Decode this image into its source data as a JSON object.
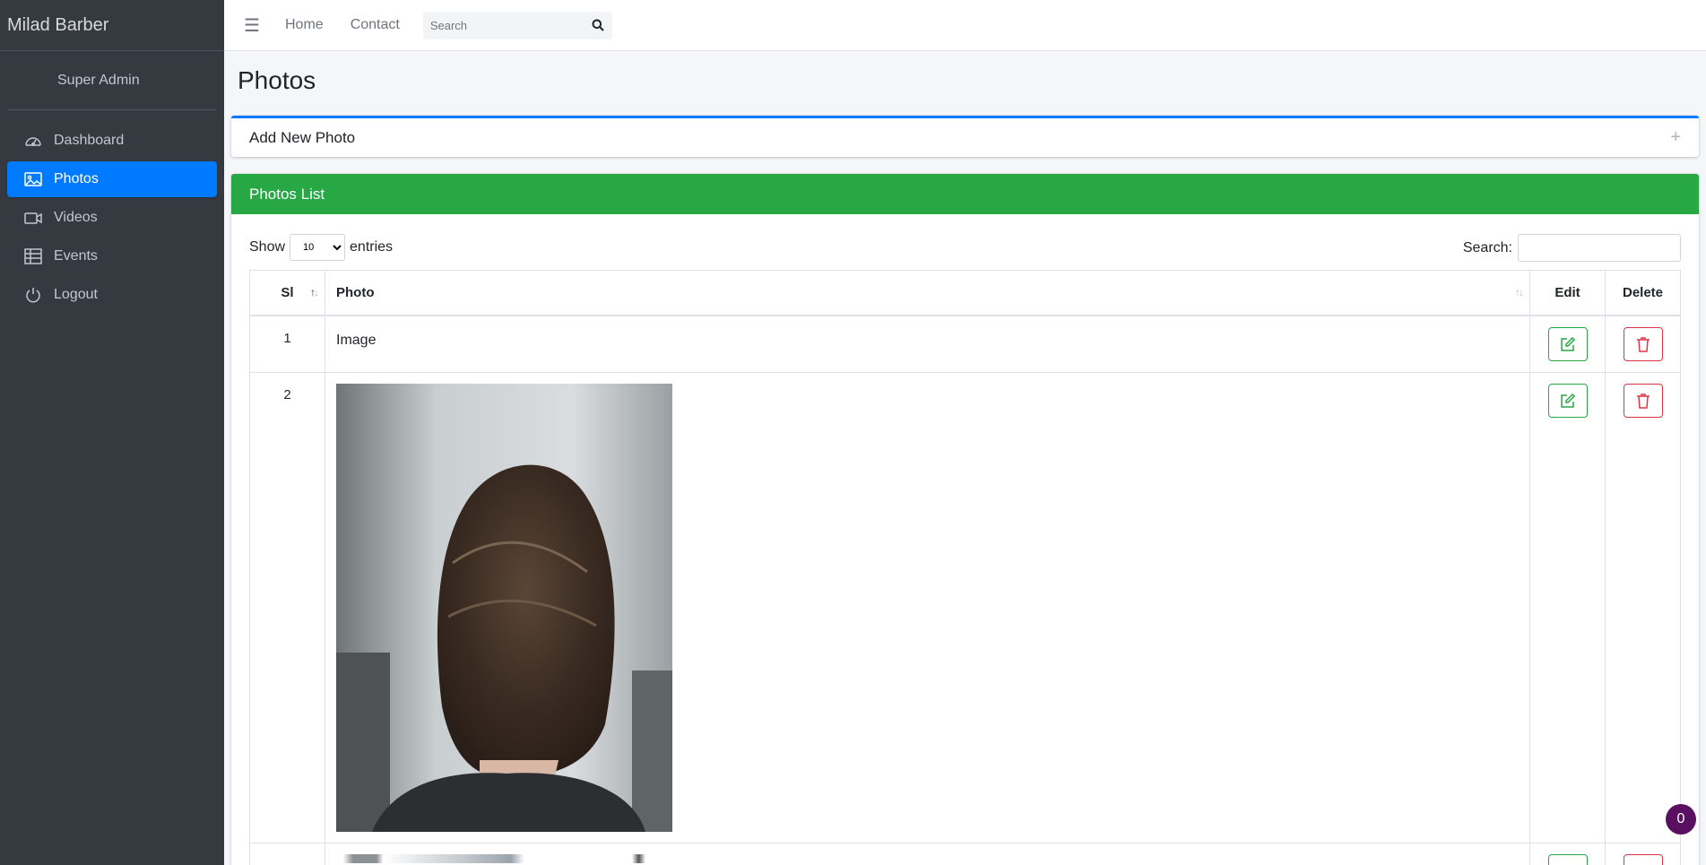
{
  "brand": "Milad Barber",
  "user": "Super Admin",
  "sidebar": {
    "items": [
      {
        "label": "Dashboard",
        "icon": "dashboard-icon"
      },
      {
        "label": "Photos",
        "icon": "image-icon",
        "active": true
      },
      {
        "label": "Videos",
        "icon": "video-icon"
      },
      {
        "label": "Events",
        "icon": "table-icon"
      },
      {
        "label": "Logout",
        "icon": "power-icon"
      }
    ]
  },
  "topbar": {
    "home": "Home",
    "contact": "Contact",
    "search_placeholder": "Search"
  },
  "page": {
    "title": "Photos",
    "add_card_title": "Add New Photo",
    "list_card_title": "Photos List"
  },
  "table_controls": {
    "show_label": "Show",
    "entries_label": "entries",
    "page_size": "10",
    "search_label": "Search:"
  },
  "table": {
    "columns": [
      "Sl",
      "Photo",
      "Edit",
      "Delete"
    ],
    "rows": [
      {
        "sl": "1",
        "photo_text": "Image"
      },
      {
        "sl": "2",
        "photo_text": ""
      }
    ]
  },
  "colors": {
    "sidebar_bg": "#343a40",
    "active": "#007bff",
    "success": "#28a745",
    "danger": "#dc3545"
  },
  "badge_count": "0"
}
